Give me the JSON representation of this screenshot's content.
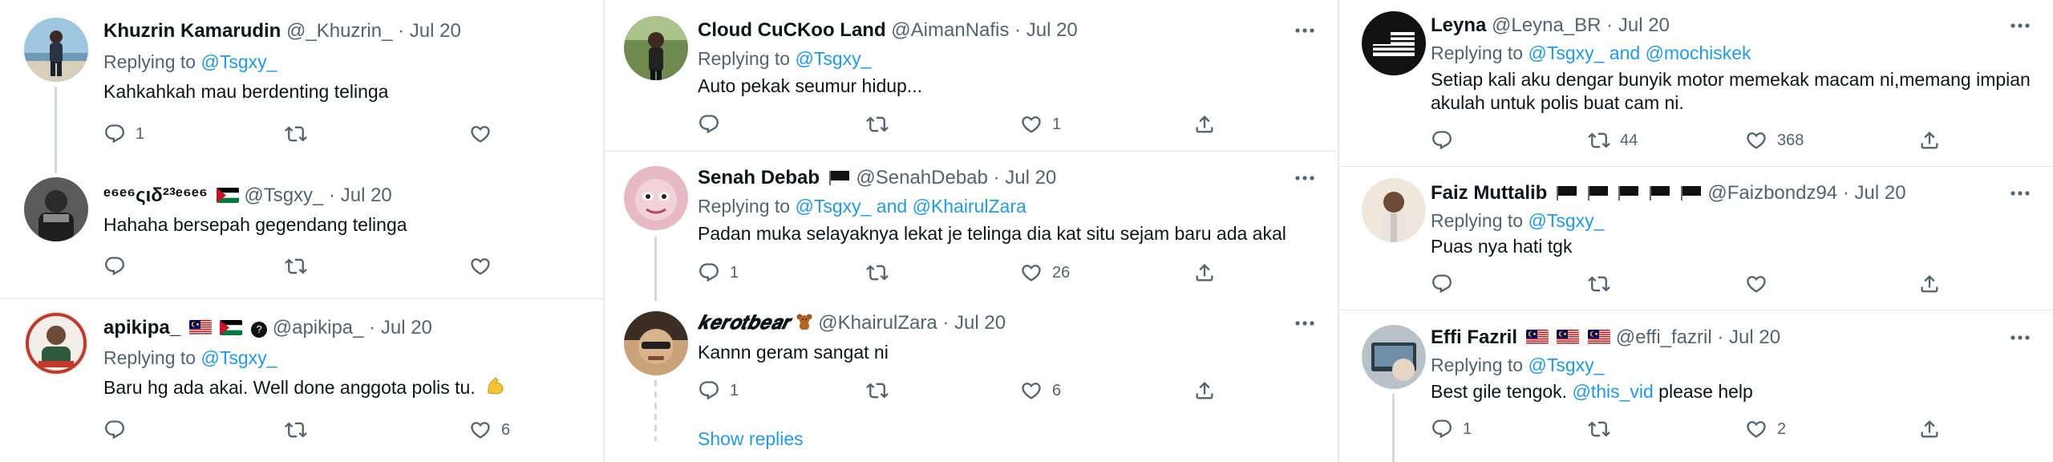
{
  "colors": {
    "link": "#1d9bf0",
    "muted": "#536471",
    "text": "#0f1419",
    "thread": "#cfd9de"
  },
  "icons": [
    "reply-icon",
    "retweet-icon",
    "like-icon",
    "share-icon",
    "more-icon",
    "malaysia-flag-icon",
    "palestine-flag-icon",
    "black-flag-icon",
    "verified-icon",
    "flexed-bicep-emoji",
    "teddy-bear-emoji"
  ],
  "columns": [
    {
      "tweets": [
        {
          "name": "Khuzrin Kamarudin",
          "handle": "@_Khuzrin_",
          "date": "Jul 20",
          "replying_prefix": "Replying to",
          "mentions": [
            "@Tsgxy_"
          ],
          "mention_joiner": "",
          "text": "Kahkahkah mau berdenting telinga",
          "reply_count": "1",
          "retweet_count": "",
          "like_count": ""
        },
        {
          "name": "ᵉ⁶ᵉ⁶ςιδ²³ᵉ⁶ᵉ⁶",
          "handle": "@Tsgxy_",
          "date": "Jul 20",
          "replying_prefix": "",
          "mentions": [],
          "mention_joiner": "",
          "text": "Hahaha bersepah gegendang telinga",
          "reply_count": "",
          "retweet_count": "",
          "like_count": ""
        },
        {
          "name": "apikipa_",
          "handle": "@apikipa_",
          "date": "Jul 20",
          "replying_prefix": "Replying to",
          "mentions": [
            "@Tsgxy_"
          ],
          "mention_joiner": "",
          "text": "Baru hg ada akai. Well done anggota polis tu.",
          "reply_count": "",
          "retweet_count": "",
          "like_count": "6"
        }
      ]
    },
    {
      "tweets": [
        {
          "name": "Cloud CuCKoo Land",
          "handle": "@AimanNafis",
          "date": "Jul 20",
          "replying_prefix": "Replying to",
          "mentions": [
            "@Tsgxy_"
          ],
          "mention_joiner": "",
          "text": "Auto pekak seumur hidup...",
          "reply_count": "",
          "retweet_count": "",
          "like_count": "1"
        },
        {
          "name": "Senah Debab",
          "handle": "@SenahDebab",
          "date": "Jul 20",
          "replying_prefix": "Replying to",
          "mentions": [
            "@Tsgxy_",
            "@KhairulZara"
          ],
          "mention_joiner": "and",
          "text": "Padan muka selayaknya lekat je telinga dia kat situ sejam baru ada akal",
          "reply_count": "1",
          "retweet_count": "",
          "like_count": "26"
        },
        {
          "name": "𝒌𝒆𝒓𝒐𝒕𝒃𝒆𝒂𝒓",
          "handle": "@KhairulZara",
          "date": "Jul 20",
          "replying_prefix": "",
          "mentions": [],
          "mention_joiner": "",
          "text": "Kannn geram sangat ni",
          "reply_count": "1",
          "retweet_count": "",
          "like_count": "6"
        }
      ],
      "show_replies": "Show replies"
    },
    {
      "tweets": [
        {
          "name": "Leyna",
          "handle": "@Leyna_BR",
          "date": "Jul 20",
          "replying_prefix": "Replying to",
          "mentions": [
            "@Tsgxy_",
            "@mochiskek"
          ],
          "mention_joiner": "and",
          "text_lines": [
            "Setiap kali aku dengar bunyik motor memekak macam ni,memang impian",
            "akulah untuk polis buat cam ni."
          ],
          "reply_count": "",
          "retweet_count": "44",
          "like_count": "368"
        },
        {
          "name": "Faiz Muttalib",
          "handle": "@Faizbondz94",
          "date": "Jul 20",
          "replying_prefix": "Replying to",
          "mentions": [
            "@Tsgxy_"
          ],
          "mention_joiner": "",
          "text": "Puas nya hati tgk",
          "reply_count": "",
          "retweet_count": "",
          "like_count": ""
        },
        {
          "name": "Effi Fazril",
          "handle": "@effi_fazril",
          "date": "Jul 20",
          "replying_prefix": "Replying to",
          "mentions": [
            "@Tsgxy_"
          ],
          "mention_joiner": "",
          "text_parts": [
            "Best gile tengok. ",
            "@this_vid",
            " please help"
          ],
          "reply_count": "1",
          "retweet_count": "",
          "like_count": "2"
        }
      ]
    }
  ]
}
